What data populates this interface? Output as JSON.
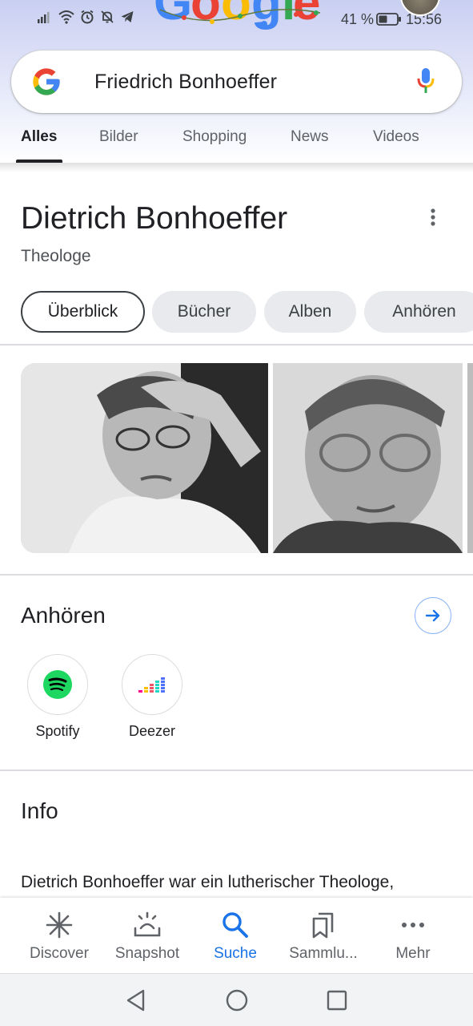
{
  "status_bar": {
    "battery_percent": "41 %",
    "time": "15:56",
    "icons": [
      "signal-icon",
      "wifi-icon",
      "alarm-icon",
      "mute-icon",
      "telegram-icon",
      "battery-icon"
    ]
  },
  "search": {
    "query": "Friedrich Bonhoeffer"
  },
  "tabs": [
    {
      "label": "Alles",
      "active": true
    },
    {
      "label": "Bilder",
      "active": false
    },
    {
      "label": "Shopping",
      "active": false
    },
    {
      "label": "News",
      "active": false
    },
    {
      "label": "Videos",
      "active": false
    }
  ],
  "entity": {
    "title": "Dietrich Bonhoeffer",
    "subtitle": "Theologe"
  },
  "chips": [
    {
      "label": "Überblick",
      "active": true
    },
    {
      "label": "Bücher",
      "active": false
    },
    {
      "label": "Alben",
      "active": false
    },
    {
      "label": "Anhören",
      "active": false
    }
  ],
  "listen": {
    "heading": "Anhören",
    "providers": [
      {
        "label": "Spotify",
        "icon": "spotify-icon"
      },
      {
        "label": "Deezer",
        "icon": "deezer-icon"
      }
    ]
  },
  "info": {
    "heading": "Info",
    "text": "Dietrich Bonhoeffer war ein lutherischer Theologe,"
  },
  "bottom_nav": [
    {
      "label": "Discover",
      "icon": "asterisk-icon",
      "active": false
    },
    {
      "label": "Snapshot",
      "icon": "snapshot-icon",
      "active": false
    },
    {
      "label": "Suche",
      "icon": "search-icon",
      "active": true
    },
    {
      "label": "Sammlu...",
      "icon": "collections-icon",
      "active": false
    },
    {
      "label": "Mehr",
      "icon": "more-icon",
      "active": false
    }
  ],
  "colors": {
    "accent": "#1a73e8",
    "spotify": "#1ed760",
    "chip_bg": "#e8eaed"
  }
}
